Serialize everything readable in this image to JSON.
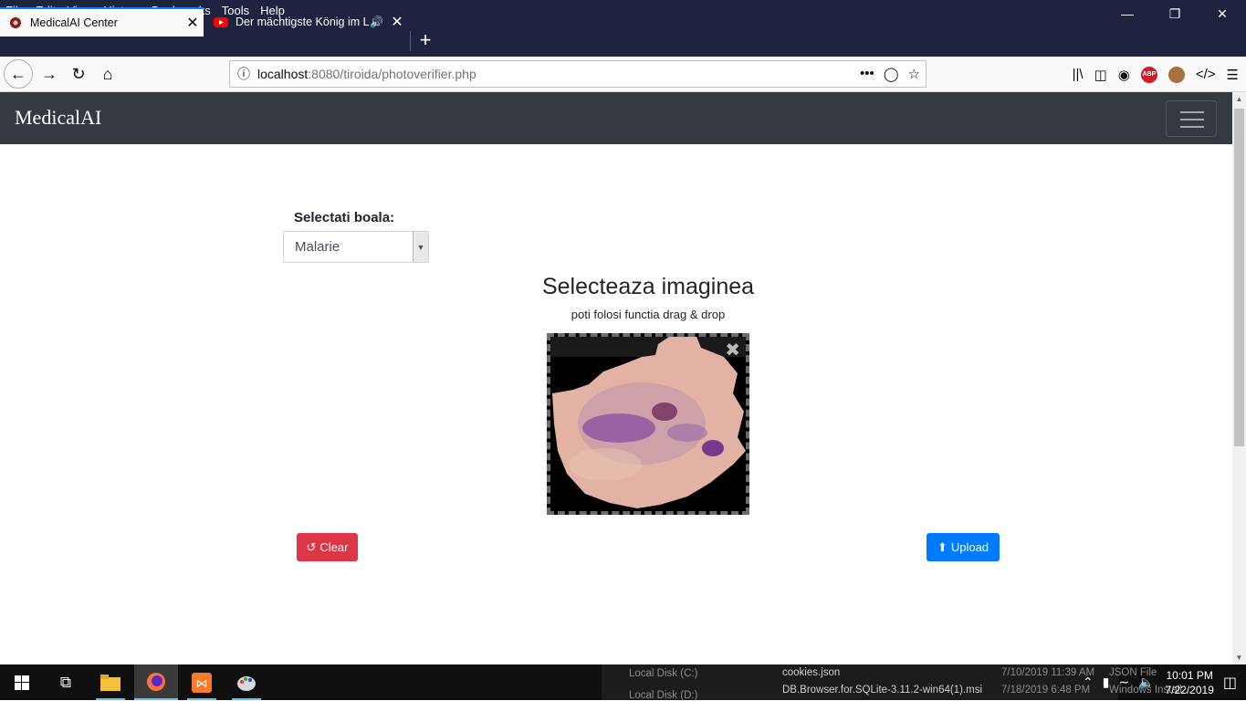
{
  "browser": {
    "menu": [
      "File",
      "Edit",
      "View",
      "History",
      "Bookmarks",
      "Tools",
      "Help"
    ],
    "tabs": [
      {
        "label": "MedicalAI Center"
      },
      {
        "label": "Der mächtigste König im Lu"
      }
    ],
    "url": {
      "host": "localhost",
      "path": ":8080/tiroida/photoverifier.php"
    }
  },
  "app": {
    "brand": "MedicalAI",
    "form": {
      "select_label": "Selectati boala:",
      "selected_disease": "Malarie"
    },
    "dropzone": {
      "title": "Selecteaza imaginea",
      "subtitle": "poti folosi functia drag & drop"
    },
    "buttons": {
      "clear": "Clear",
      "upload": "Upload",
      "clear_color": "#dc3545",
      "upload_color": "#007bff"
    }
  },
  "taskbar": {
    "peek": {
      "rows": [
        {
          "left": "Local Disk (C:)",
          "file": "cookies.json",
          "date": "7/10/2019 11:39 AM",
          "type": "JSON File"
        },
        {
          "left": "Local Disk (D:)",
          "file": "DB.Browser.for.SQLite-3.11.2-win64(1).msi",
          "date": "7/18/2019 6:48 PM",
          "type": "Windows Install..."
        }
      ]
    },
    "clock": {
      "time": "10:01 PM",
      "date": "7/22/2019"
    }
  }
}
